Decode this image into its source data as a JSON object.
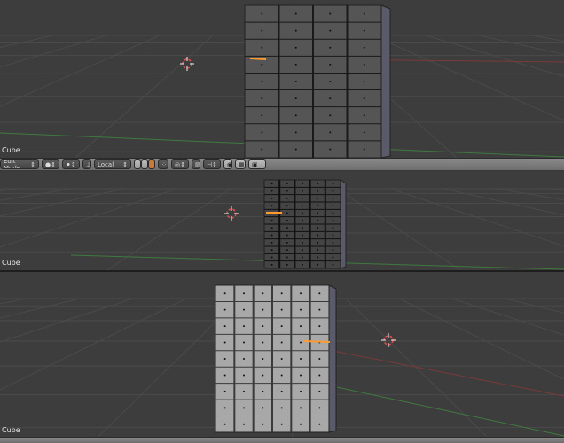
{
  "viewports": [
    {
      "object": "Cube"
    },
    {
      "object": "Cube"
    },
    {
      "object": "Cube"
    }
  ],
  "header": {
    "mode": "Edit Mode",
    "pivot": "Local"
  },
  "icons": [
    "viewport-shade-icon",
    "pivot-icon",
    "transform-orientation-icon",
    "vertex-select-icon",
    "edge-select-icon",
    "face-select-icon",
    "limit-visible-icon",
    "proportional-edit-icon",
    "snap-icon",
    "snap-target-icon",
    "render-icon"
  ],
  "colors": {
    "bg": "#3d3d3d",
    "grid": "#4a4a4a",
    "x_axis": "#7a3a3a",
    "y_axis": "#3f7a3f",
    "mesh": "#9a9a9a",
    "header": "#7d7d7d"
  }
}
